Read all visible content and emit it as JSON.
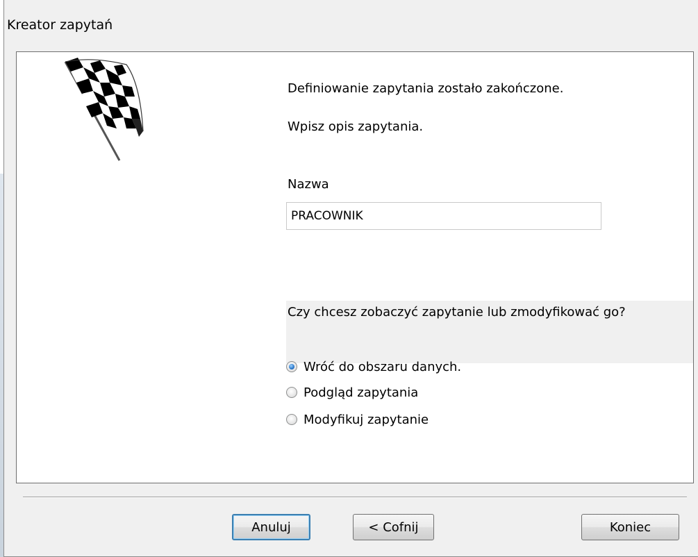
{
  "window": {
    "title": "Kreator zapytań"
  },
  "content": {
    "heading1": "Definiowanie zapytania zostało zakończone.",
    "heading2": "Wpisz opis zapytania.",
    "name_label": "Nazwa",
    "name_value": "PRACOWNIK",
    "question": "Czy chcesz zobaczyć zapytanie lub zmodyfikować go?",
    "options": [
      {
        "label": "Wróć do obszaru danych.",
        "selected": true
      },
      {
        "label": "Podgląd zapytania",
        "selected": false
      },
      {
        "label": "Modyfikuj zapytanie",
        "selected": false
      }
    ],
    "image_icon": "checkered-flag-icon"
  },
  "buttons": {
    "cancel": "Anuluj",
    "back": "< Cofnij",
    "finish": "Koniec"
  },
  "colors": {
    "dialog_bg": "#f0f0f0",
    "content_bg": "#ffffff",
    "accent_focus": "#3c7fb1"
  }
}
